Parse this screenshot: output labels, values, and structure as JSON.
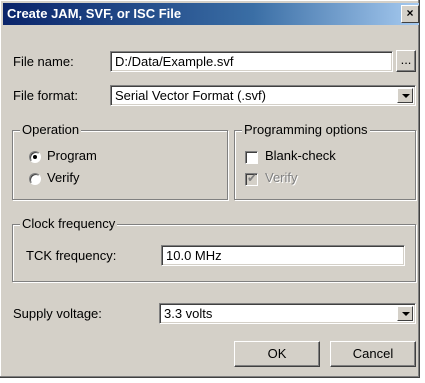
{
  "window": {
    "title": "Create JAM, SVF, or ISC File",
    "close_glyph": "×"
  },
  "file": {
    "name_label": "File name:",
    "name_value": "D:/Data/Example.svf",
    "browse_label": "...",
    "format_label": "File format:",
    "format_value": "Serial Vector Format (.svf)"
  },
  "operation": {
    "title": "Operation",
    "options": [
      {
        "label": "Program",
        "selected": true
      },
      {
        "label": "Verify",
        "selected": false
      }
    ]
  },
  "programming_options": {
    "title": "Programming options",
    "blank_check_label": "Blank-check",
    "blank_check_checked": false,
    "verify_label": "Verify",
    "verify_checked": true,
    "verify_disabled": true
  },
  "clock": {
    "title": "Clock frequency",
    "tck_label": "TCK frequency:",
    "tck_value": "10.0 MHz"
  },
  "supply": {
    "label": "Supply voltage:",
    "value": "3.3 volts"
  },
  "buttons": {
    "ok": "OK",
    "cancel": "Cancel"
  },
  "colors": {
    "title_bar_start": "#0a246a",
    "title_bar_end": "#a6caf0",
    "face": "#d4d0c8"
  }
}
